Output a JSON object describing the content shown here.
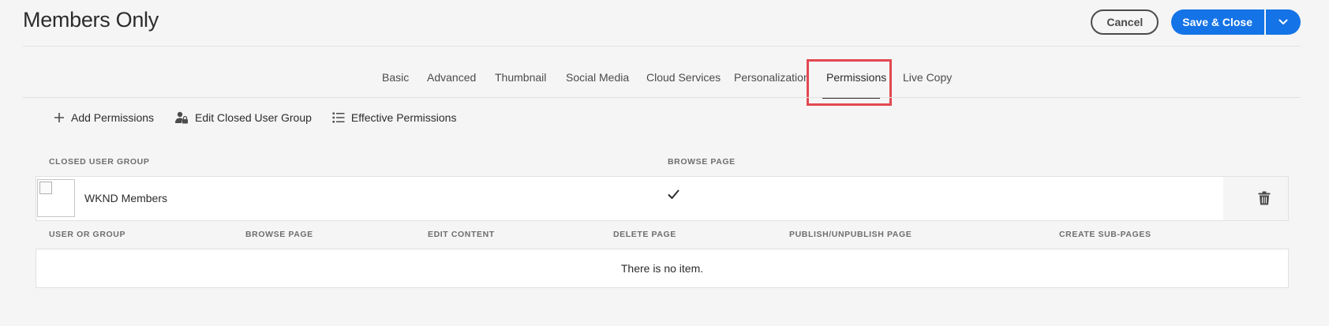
{
  "header": {
    "title": "Members Only",
    "cancel_label": "Cancel",
    "save_label": "Save & Close"
  },
  "tabs": [
    {
      "label": "Basic"
    },
    {
      "label": "Advanced"
    },
    {
      "label": "Thumbnail"
    },
    {
      "label": "Social Media"
    },
    {
      "label": "Cloud Services"
    },
    {
      "label": "Personalization"
    },
    {
      "label": "Permissions",
      "active": true
    },
    {
      "label": "Live Copy"
    }
  ],
  "toolbar": {
    "add_permissions": "Add Permissions",
    "edit_cug": "Edit Closed User Group",
    "effective_permissions": "Effective Permissions"
  },
  "cug_table": {
    "headers": [
      "CLOSED USER GROUP",
      "BROWSE PAGE"
    ],
    "rows": [
      {
        "name": "WKND Members",
        "browse_page": true
      }
    ]
  },
  "permissions_table": {
    "headers": [
      "USER OR GROUP",
      "BROWSE PAGE",
      "EDIT CONTENT",
      "DELETE PAGE",
      "PUBLISH/UNPUBLISH PAGE",
      "CREATE SUB-PAGES"
    ],
    "empty_text": "There is no item."
  },
  "colors": {
    "accent": "#1473e6",
    "highlight": "#e34850",
    "background": "#f5f5f5"
  }
}
